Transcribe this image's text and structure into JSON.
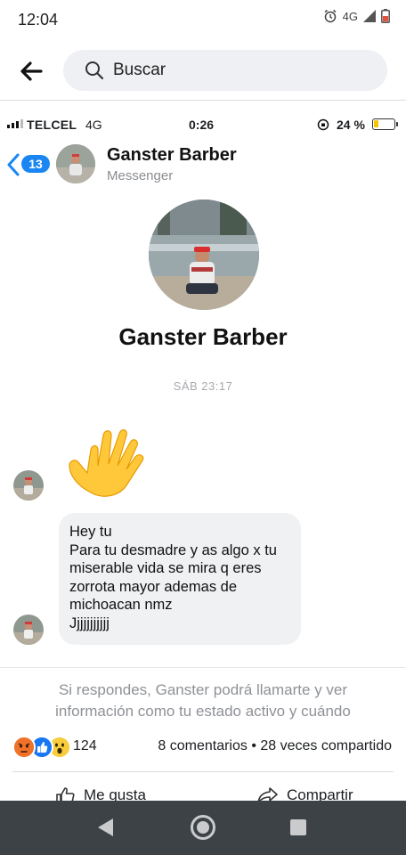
{
  "android_status": {
    "time": "12:04",
    "network": "4G"
  },
  "fb_header": {
    "search_placeholder": "Buscar"
  },
  "ios_status": {
    "carrier": "TELCEL",
    "network": "4G",
    "time": "0:26",
    "battery_pct": "24 %",
    "battery_level": 0.24
  },
  "messenger": {
    "unread_badge": "13",
    "contact_name": "Ganster Barber",
    "contact_sub": "Messenger",
    "profile_name": "Ganster Barber",
    "timestamp": "SÁB 23:17",
    "wave_emoji": "👋",
    "message_lines": [
      "Hey tu",
      "Para tu desmadre y as algo x tu",
      "miserable vida se mira q eres",
      "zorrota mayor ademas de",
      "michoacan nmz",
      "Jjjjjjjjjjj"
    ],
    "notice_lines": [
      "Si respondes, Ganster podrá llamarte y ver",
      "información como tu estado activo y cuándo"
    ]
  },
  "post": {
    "reaction_count": "124",
    "stats": "8 comentarios • 28 veces compartido",
    "like_label": "Me gusta",
    "share_label": "Compartir",
    "reaction_icons": [
      "angry-icon",
      "like-icon",
      "wow-icon"
    ]
  },
  "colors": {
    "messenger_blue": "#1a86f4",
    "battery_yellow": "#f5c400",
    "navbar": "#3d4246",
    "bubble": "#f0f1f3"
  }
}
